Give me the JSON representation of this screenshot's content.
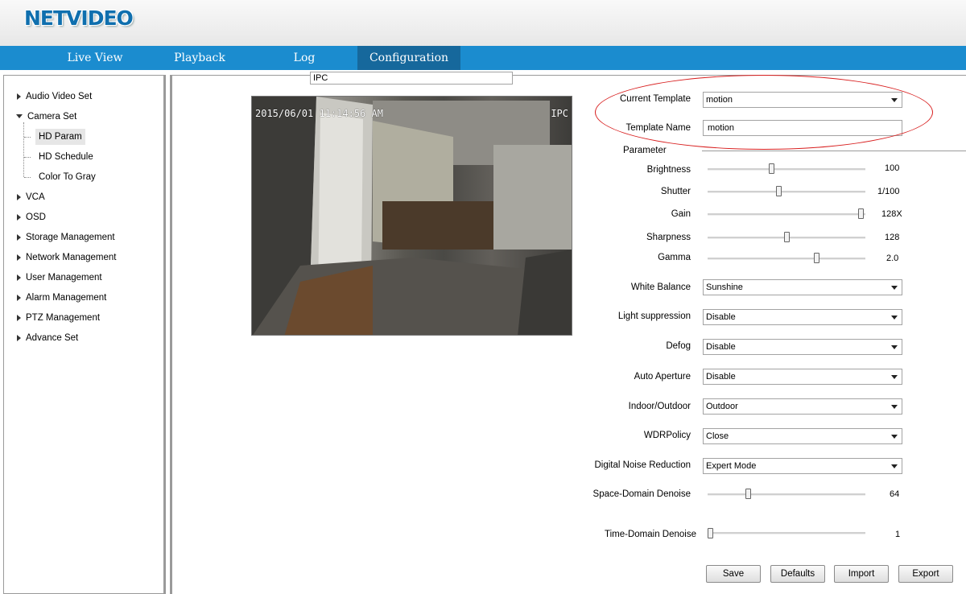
{
  "app": {
    "logo": "NETVIDEO"
  },
  "nav": {
    "tabs": [
      {
        "label": "Live View"
      },
      {
        "label": "Playback"
      },
      {
        "label": "Log"
      },
      {
        "label": "Configuration",
        "active": true
      }
    ]
  },
  "sidebar": {
    "items": [
      {
        "label": "Audio Video Set",
        "expanded": false
      },
      {
        "label": "Camera Set",
        "expanded": true
      },
      {
        "label": "VCA",
        "expanded": false
      },
      {
        "label": "OSD",
        "expanded": false
      },
      {
        "label": "Storage Management",
        "expanded": false
      },
      {
        "label": "Network Management",
        "expanded": false
      },
      {
        "label": "User Management",
        "expanded": false
      },
      {
        "label": "Alarm Management",
        "expanded": false
      },
      {
        "label": "PTZ Management",
        "expanded": false
      },
      {
        "label": "Advance Set",
        "expanded": false
      }
    ],
    "camera_subitems": [
      {
        "label": "HD Param",
        "selected": true
      },
      {
        "label": "HD Schedule"
      },
      {
        "label": "Color To Gray"
      }
    ]
  },
  "video": {
    "timestamp": "2015/06/01 11:14:56 AM",
    "channel_label": "IPC",
    "channel_select_value": "IPC"
  },
  "form": {
    "current_template": {
      "label": "Current Template",
      "value": "motion"
    },
    "template_name": {
      "label": "Template Name",
      "value": "motion"
    },
    "parameter_heading": "Parameter",
    "sliders": {
      "brightness": {
        "label": "Brightness",
        "display": "100",
        "fraction": 0.4
      },
      "shutter": {
        "label": "Shutter",
        "display": "1/100",
        "fraction": 0.45
      },
      "gain": {
        "label": "Gain",
        "display": "128X",
        "fraction": 0.99
      },
      "sharpness": {
        "label": "Sharpness",
        "display": "128",
        "fraction": 0.5
      },
      "gamma": {
        "label": "Gamma",
        "display": "2.0",
        "fraction": 0.7
      },
      "space_denoise": {
        "label": "Space-Domain Denoise",
        "display": "64",
        "fraction": 0.25
      },
      "time_denoise": {
        "label": "Time-Domain Denoise",
        "display": "1",
        "fraction": 0.0
      }
    },
    "selects": {
      "white_balance": {
        "label": "White Balance",
        "value": "Sunshine"
      },
      "light_suppression": {
        "label": "Light suppression",
        "value": "Disable"
      },
      "defog": {
        "label": "Defog",
        "value": "Disable"
      },
      "auto_aperture": {
        "label": "Auto Aperture",
        "value": "Disable"
      },
      "indoor_outdoor": {
        "label": "Indoor/Outdoor",
        "value": "Outdoor"
      },
      "wdr_policy": {
        "label": "WDRPolicy",
        "value": "Close"
      },
      "dnr": {
        "label": "Digital Noise Reduction",
        "value": "Expert Mode"
      }
    },
    "buttons": {
      "save": "Save",
      "defaults": "Defaults",
      "import": "Import",
      "export": "Export"
    }
  },
  "colors": {
    "nav_bg": "#1b8ccf",
    "nav_active": "#16689c",
    "logo": "#0f6fae",
    "highlight": "#d81f1f"
  }
}
